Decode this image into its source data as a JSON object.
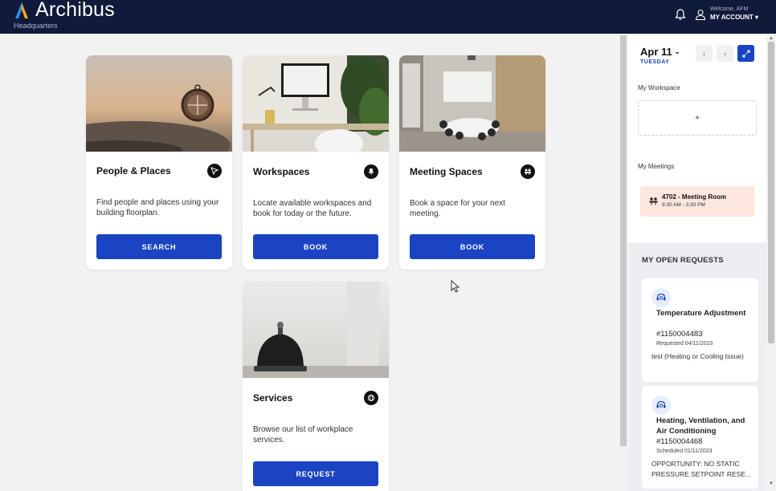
{
  "header": {
    "app_name": "Archibus",
    "location": "Headquarters",
    "welcome": "Welcome, AFM",
    "account_label": "MY ACCOUNT",
    "account_caret": "▾"
  },
  "cards": [
    {
      "title": "People & Places",
      "description": "Find people and places using your building floorplan.",
      "button": "SEARCH",
      "icon": "navigation-arrow-icon"
    },
    {
      "title": "Workspaces",
      "description": "Locate available workspaces and book for today or the future.",
      "button": "BOOK",
      "icon": "desk-chair-icon"
    },
    {
      "title": "Meeting Spaces",
      "description": "Book a space for your next meeting.",
      "button": "BOOK",
      "icon": "meeting-table-icon"
    },
    {
      "title": "Services",
      "description": "Browse our list of workplace services.",
      "button": "REQUEST",
      "icon": "service-globe-icon"
    }
  ],
  "panel": {
    "date": "Apr 11",
    "date_chevron": "⌄",
    "weekday": "TUESDAY",
    "prev": "‹",
    "next": "›",
    "my_workspace_label": "My Workspace",
    "add_symbol": "+",
    "my_meetings_label": "My Meetings",
    "meeting": {
      "title": "4702 - Meeting Room",
      "time": "9:30 AM - 3:30 PM"
    },
    "open_requests_label": "MY OPEN REQUESTS",
    "requests": [
      {
        "title": "Temperature Adjustment",
        "id": "#1150004483",
        "date": "Requested 04/11/2023",
        "desc": "test (Heating or Cooling Issue)"
      },
      {
        "title": "Heating, Ventilation, and Air Conditioning",
        "id": "#1150004468",
        "date": "Scheduled 01/11/2023",
        "desc": "OPPORTUNITY: NO STATIC PRESSURE SETPOINT RESE..."
      }
    ]
  },
  "colors": {
    "header_bg": "#101a3a",
    "accent": "#1a44c2",
    "meeting_bg": "#fde6dd"
  }
}
